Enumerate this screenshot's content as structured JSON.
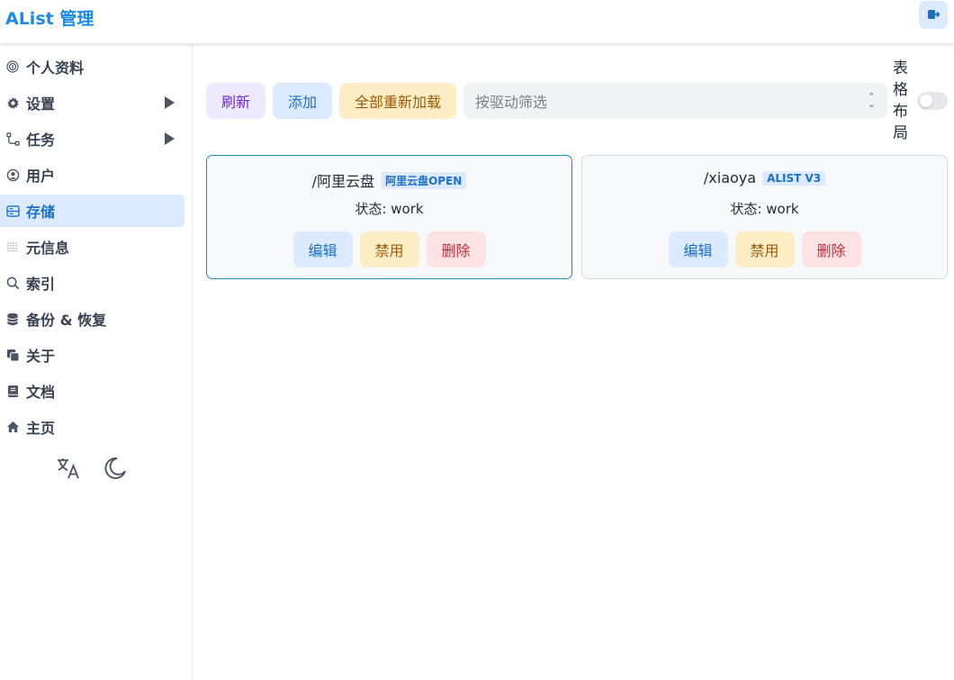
{
  "header": {
    "title": "AList 管理"
  },
  "sidebar": {
    "items": [
      {
        "label": "个人资料",
        "icon": "fingerprint-icon",
        "has_children": false,
        "active": false
      },
      {
        "label": "设置",
        "icon": "gear-icon",
        "has_children": true,
        "active": false
      },
      {
        "label": "任务",
        "icon": "route-icon",
        "has_children": true,
        "active": false
      },
      {
        "label": "用户",
        "icon": "user-circle-icon",
        "has_children": false,
        "active": false
      },
      {
        "label": "存储",
        "icon": "storage-icon",
        "has_children": false,
        "active": true
      },
      {
        "label": "元信息",
        "icon": "metadata-icon",
        "has_children": false,
        "active": false
      },
      {
        "label": "索引",
        "icon": "search-icon",
        "has_children": false,
        "active": false
      },
      {
        "label": "备份 & 恢复",
        "icon": "database-icon",
        "has_children": false,
        "active": false
      },
      {
        "label": "关于",
        "icon": "copy-icon",
        "has_children": false,
        "active": false
      },
      {
        "label": "文档",
        "icon": "book-icon",
        "has_children": false,
        "active": false
      },
      {
        "label": "主页",
        "icon": "home-icon",
        "has_children": false,
        "active": false
      }
    ]
  },
  "toolbar": {
    "refresh_label": "刷新",
    "add_label": "添加",
    "reload_all_label": "全部重新加载",
    "driver_filter_placeholder": "按驱动筛选",
    "table_layout_label": "表格布局",
    "table_layout_on": false
  },
  "storages": [
    {
      "mount_path": "/阿里云盘",
      "driver": "阿里云盘OPEN",
      "status": "状态: work",
      "edit_label": "编辑",
      "disable_label": "禁用",
      "delete_label": "删除"
    },
    {
      "mount_path": "/xiaoya",
      "driver": "ALIST V3",
      "status": "状态: work",
      "edit_label": "编辑",
      "disable_label": "禁用",
      "delete_label": "删除"
    }
  ],
  "colors": {
    "brand": "#1a8ce8",
    "active_nav_bg": "#dbeafe",
    "card_highlight_border": "#1a8fb5"
  }
}
